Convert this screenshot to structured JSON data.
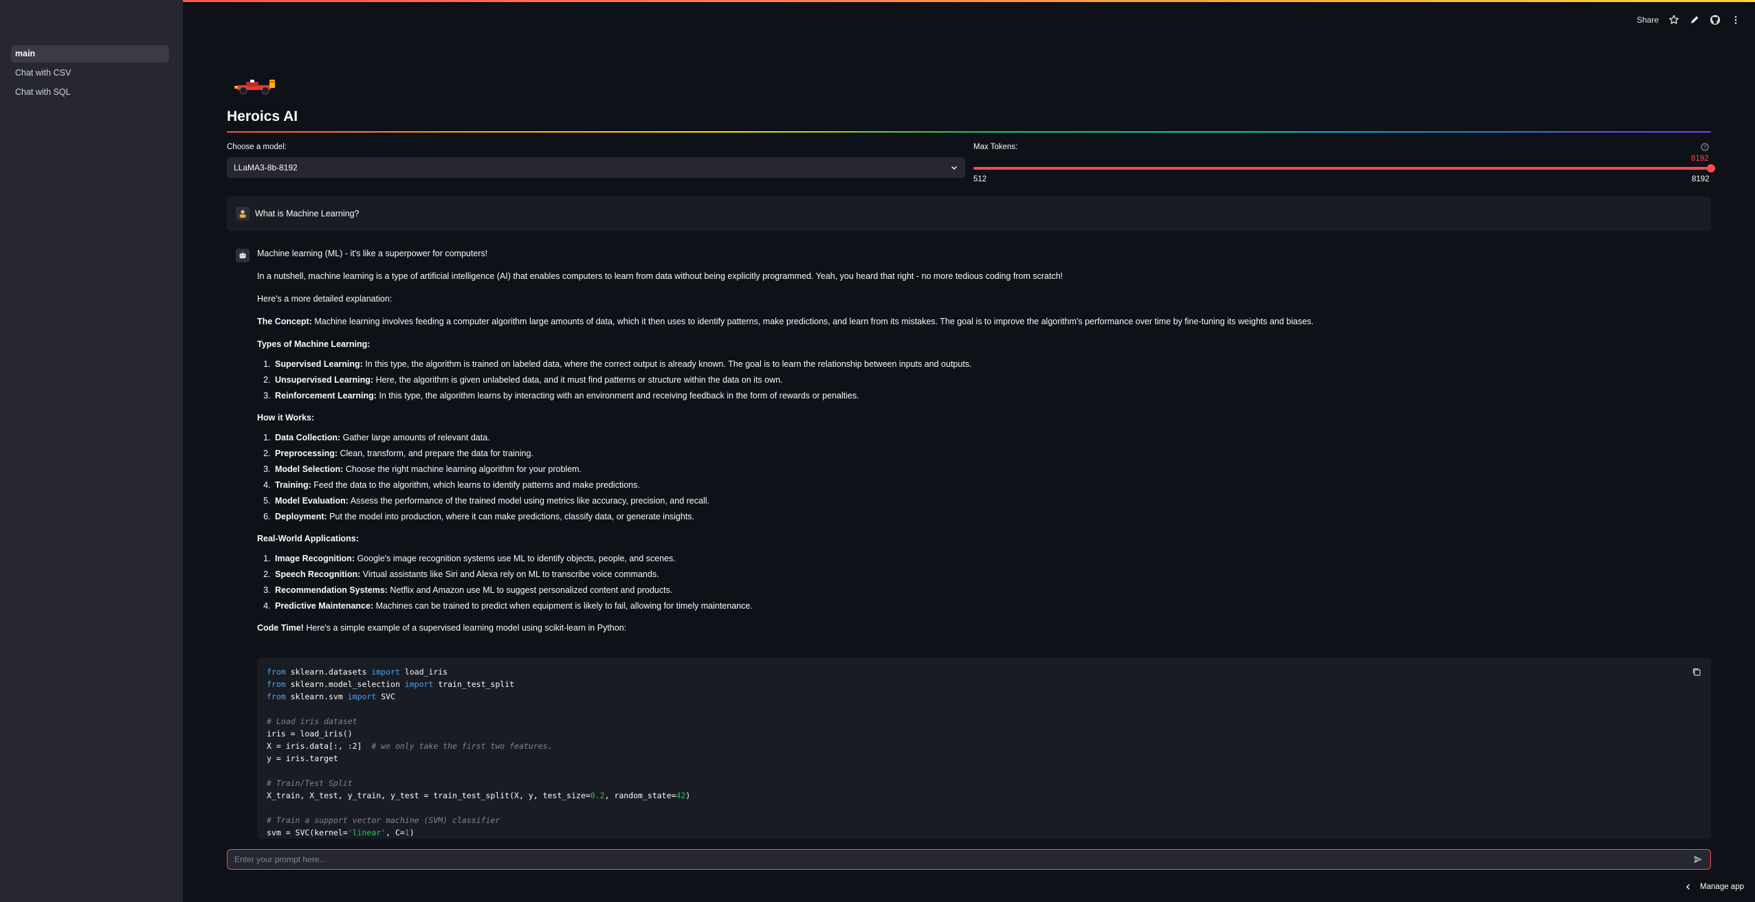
{
  "sidebar": {
    "items": [
      {
        "label": "main",
        "active": true
      },
      {
        "label": "Chat with CSV",
        "active": false
      },
      {
        "label": "Chat with SQL",
        "active": false
      }
    ]
  },
  "toolbar": {
    "share_label": "Share",
    "icons": [
      "star-icon",
      "edit-icon",
      "github-icon",
      "more-vert-icon"
    ]
  },
  "app": {
    "title": "Heroics AI",
    "logo_icon": "race-car-icon"
  },
  "model_select": {
    "label": "Choose a model:",
    "value": "LLaMA3-8b-8192"
  },
  "max_tokens": {
    "label": "Max Tokens:",
    "value": "8192",
    "min": "512",
    "max": "8192",
    "fraction": 1.0
  },
  "chat": {
    "user_message": "What is Machine Learning?",
    "assistant": {
      "intro": "Machine learning (ML) - it's like a superpower for computers!",
      "nutshell": "In a nutshell, machine learning is a type of artificial intelligence (AI) that enables computers to learn from data without being explicitly programmed. Yeah, you heard that right - no more tedious coding from scratch!",
      "more": "Here's a more detailed explanation:",
      "concept_label": "The Concept:",
      "concept_text": " Machine learning involves feeding a computer algorithm large amounts of data, which it then uses to identify patterns, make predictions, and learn from its mistakes. The goal is to improve the algorithm's performance over time by fine-tuning its weights and biases.",
      "types_heading": "Types of Machine Learning:",
      "types": [
        {
          "label": "Supervised Learning:",
          "text": " In this type, the algorithm is trained on labeled data, where the correct output is already known. The goal is to learn the relationship between inputs and outputs."
        },
        {
          "label": "Unsupervised Learning:",
          "text": " Here, the algorithm is given unlabeled data, and it must find patterns or structure within the data on its own."
        },
        {
          "label": "Reinforcement Learning:",
          "text": " In this type, the algorithm learns by interacting with an environment and receiving feedback in the form of rewards or penalties."
        }
      ],
      "how_heading": "How it Works:",
      "steps": [
        {
          "label": "Data Collection:",
          "text": " Gather large amounts of relevant data."
        },
        {
          "label": "Preprocessing:",
          "text": " Clean, transform, and prepare the data for training."
        },
        {
          "label": "Model Selection:",
          "text": " Choose the right machine learning algorithm for your problem."
        },
        {
          "label": "Training:",
          "text": " Feed the data to the algorithm, which learns to identify patterns and make predictions."
        },
        {
          "label": "Model Evaluation:",
          "text": " Assess the performance of the trained model using metrics like accuracy, precision, and recall."
        },
        {
          "label": "Deployment:",
          "text": " Put the model into production, where it can make predictions, classify data, or generate insights."
        }
      ],
      "apps_heading": "Real-World Applications:",
      "apps": [
        {
          "label": "Image Recognition:",
          "text": " Google's image recognition systems use ML to identify objects, people, and scenes."
        },
        {
          "label": "Speech Recognition:",
          "text": " Virtual assistants like Siri and Alexa rely on ML to transcribe voice commands."
        },
        {
          "label": "Recommendation Systems:",
          "text": " Netflix and Amazon use ML to suggest personalized content and products."
        },
        {
          "label": "Predictive Maintenance:",
          "text": " Machines can be trained to predict when equipment is likely to fail, allowing for timely maintenance."
        }
      ],
      "code_label": "Code Time!",
      "code_intro": " Here's a simple example of a supervised learning model using scikit-learn in Python:"
    }
  },
  "code": {
    "l1": [
      "from",
      " sklearn.datasets ",
      "import",
      " load_iris"
    ],
    "l2": [
      "from",
      " sklearn.model_selection ",
      "import",
      " train_test_split"
    ],
    "l3": [
      "from",
      " sklearn.svm ",
      "import",
      " SVC"
    ],
    "l5": "# Load iris dataset",
    "l6": "iris = load_iris()",
    "l7a": "X = iris.data[:, :2]  ",
    "l7b": "# we only take the first two features.",
    "l8": "y = iris.target",
    "l10": "# Train/Test Split",
    "l11a": "X_train, X_test, y_train, y_test = train_test_split(X, y, test_size=",
    "l11b": "0.2",
    "l11c": ", random_state=",
    "l11d": "42",
    "l11e": ")",
    "l13": "# Train a support vector machine (SVM) classifier",
    "l14a": "svm = SVC(kernel=",
    "l14b": "'linear'",
    "l14c": ", C=",
    "l14d": "1",
    "l14e": ")"
  },
  "prompt": {
    "placeholder": "Enter your prompt here..."
  },
  "footer": {
    "manage_label": "Manage app"
  },
  "colors": {
    "accent": "#ff4b4b",
    "background": "#0e1117",
    "sidebar": "#262730"
  }
}
